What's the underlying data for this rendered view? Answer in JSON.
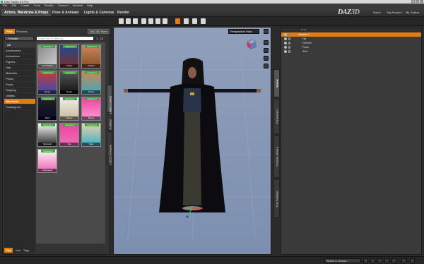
{
  "app": {
    "title": "DAZ Studio 4.6 Pro"
  },
  "window_controls": [
    "_",
    "□",
    "x"
  ],
  "menu": [
    "File",
    "Edit",
    "Create",
    "Tools",
    "Render",
    "Connect",
    "Window",
    "Help"
  ],
  "main_tabs": [
    {
      "label": "Actors, Wardrobe & Props",
      "active": true
    },
    {
      "label": "Pose & Animate",
      "active": false
    },
    {
      "label": "Lights & Cameras",
      "active": false
    },
    {
      "label": "Render",
      "active": false
    }
  ],
  "brand": {
    "daz": "DAZ",
    "three_d": "3D"
  },
  "top_links": {
    "home": "Home",
    "account": "My Account",
    "gallery": "My Gallery"
  },
  "left_panel": {
    "tabs": [
      "Files",
      "Products"
    ],
    "store_button": "DAZ 3D Store",
    "filter": "Female",
    "search_placeholder": "Enter text to filter by...",
    "pager": "1 - 13",
    "categories": [
      {
        "label": "All",
        "head": true
      },
      {
        "label": "Accessories"
      },
      {
        "label": "Animations"
      },
      {
        "label": "Figures"
      },
      {
        "label": "Hair"
      },
      {
        "label": "Materials"
      },
      {
        "label": "Poses"
      },
      {
        "label": "Props"
      },
      {
        "label": "Shaping"
      },
      {
        "label": "Utilities"
      },
      {
        "label": "Wardrobe",
        "active": true
      },
      {
        "label": "Unassigned"
      }
    ],
    "badge": "Genesis 2",
    "thumbs": [
      {
        "caption": "CLOTHING"
      },
      {
        "caption": "Tuffop"
      },
      {
        "caption": "Panties"
      },
      {
        "caption": "Pants"
      },
      {
        "caption": "Pants"
      },
      {
        "caption": "Pants"
      },
      {
        "caption": "Shirt"
      },
      {
        "caption": "Shoes"
      },
      {
        "caption": "Shoes"
      },
      {
        "caption": "Swimsuit"
      },
      {
        "caption": "Top"
      },
      {
        "caption": "Tank"
      },
      {
        "caption": "Underwear"
      }
    ],
    "side_tabs": [
      "Smart Content",
      "Shaping",
      "Surfaces (Color)"
    ],
    "bottom_tabs": [
      "Tips",
      "Info",
      "Tags"
    ]
  },
  "viewport": {
    "view_label": "Perspective View"
  },
  "right_side_tabs": [
    "Scene",
    "Parameters",
    "Content Library",
    "Tool Settings"
  ],
  "scene": {
    "header": "Node",
    "rows": [
      {
        "label": "Genesis 2",
        "active": true,
        "indent": 0
      },
      {
        "label": "Hip",
        "indent": 1
      },
      {
        "label": "HZRobe",
        "indent": 1
      },
      {
        "label": "Pants",
        "indent": 1
      },
      {
        "label": "Shirt",
        "indent": 1
      }
    ]
  },
  "status": {
    "lesson": "Select a Lesson..."
  },
  "colors": {
    "accent": "#e07c10",
    "badge": "#33aa33",
    "viewport": "#8b9bb8"
  }
}
